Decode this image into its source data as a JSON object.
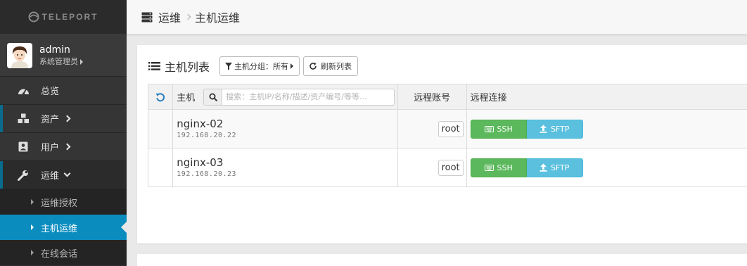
{
  "sidebar": {
    "logo_text": "TELEPORT",
    "user": {
      "name": "admin",
      "role": "系统管理员"
    },
    "nav": [
      {
        "label": "总览",
        "icon": "dashboard-icon"
      },
      {
        "label": "资产",
        "icon": "cubes-icon"
      },
      {
        "label": "用户",
        "icon": "user-card-icon"
      },
      {
        "label": "运维",
        "icon": "wrench-icon"
      }
    ],
    "subnav": [
      {
        "label": "运维授权"
      },
      {
        "label": "主机运维"
      },
      {
        "label": "在线会话"
      }
    ]
  },
  "breadcrumb": {
    "icon": "server-icon",
    "parent": "运维",
    "current": "主机运维"
  },
  "panel": {
    "title": "主机列表",
    "group_filter_label": "主机分组：",
    "group_filter_value": "所有",
    "refresh_label": "刷新列表"
  },
  "table": {
    "headers": {
      "host": "主机",
      "account": "远程账号",
      "connect": "远程连接"
    },
    "search_placeholder": "搜索：主机IP/名称/描述/资产编号/等等...",
    "rows": [
      {
        "name": "nginx-02",
        "ip": "192.168.20.22",
        "account": "root",
        "ssh": "SSH",
        "sftp": "SFTP"
      },
      {
        "name": "nginx-03",
        "ip": "192.168.20.23",
        "account": "root",
        "ssh": "SSH",
        "sftp": "SFTP"
      }
    ]
  },
  "colors": {
    "accent": "#0b8cbf",
    "ssh": "#5cb85c",
    "sftp": "#5bc0de",
    "sidebar": "#2f2f2f"
  }
}
